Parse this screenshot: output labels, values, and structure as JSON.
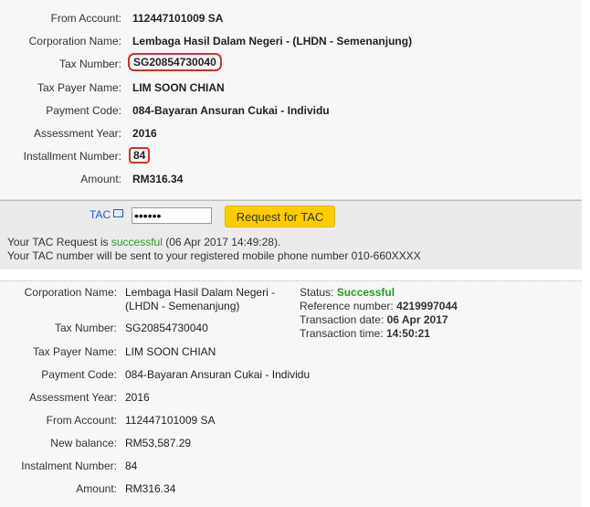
{
  "top": {
    "fields": [
      {
        "label": "From Account:",
        "value": "112447101009 SA"
      },
      {
        "label": "Corporation Name:",
        "value": "Lembaga Hasil Dalam Negeri - (LHDN - Semenanjung)"
      },
      {
        "label": "Tax Number:",
        "value": "SG20854730040"
      },
      {
        "label": "Tax Payer Name:",
        "value": "LIM SOON CHIAN"
      },
      {
        "label": "Payment Code:",
        "value": "084-Bayaran Ansuran Cukai - Individu"
      },
      {
        "label": "Assessment Year:",
        "value": "2016"
      },
      {
        "label": "Installment Number:",
        "value": "84"
      },
      {
        "label": "Amount:",
        "value": "RM316.34"
      }
    ]
  },
  "tac": {
    "label": "TAC",
    "input_value": "••••••",
    "button_label": "Request for TAC",
    "msg1_prefix": "Your TAC Request is ",
    "msg1_status": "successful",
    "msg1_suffix": " (06 Apr 2017 14:49:28).",
    "msg2": "Your TAC number will be sent to your registered mobile phone number 010-660XXXX"
  },
  "bottom": {
    "corp_label": "Corporation Name:",
    "corp_line1": "Lembaga Hasil Dalam Negeri -",
    "corp_line2": "(LHDN - Semenanjung)",
    "fields": [
      {
        "label": "Tax Number:",
        "value": "SG20854730040"
      },
      {
        "label": "Tax Payer Name:",
        "value": "LIM SOON CHIAN"
      },
      {
        "label": "Payment Code:",
        "value": "084-Bayaran Ansuran Cukai - Individu"
      },
      {
        "label": "Assessment Year:",
        "value": "2016"
      },
      {
        "label": "From Account:",
        "value": "112447101009 SA"
      },
      {
        "label": "New balance:",
        "value": "RM53,587.29"
      },
      {
        "label": "Instalment Number:",
        "value": "84"
      },
      {
        "label": "Amount:",
        "value": "RM316.34"
      }
    ],
    "status_label": "Status:",
    "status_value": "Successful",
    "ref_label": "Reference number:",
    "ref_value": "4219997044",
    "date_label": "Transaction date:",
    "date_value": "06 Apr 2017",
    "time_label": "Transaction time:",
    "time_value": "14:50:21"
  },
  "colors": {
    "highlight": "#d0302f",
    "success": "#2a9a2a",
    "button": "#ffcc00",
    "link": "#1a5cc8"
  }
}
